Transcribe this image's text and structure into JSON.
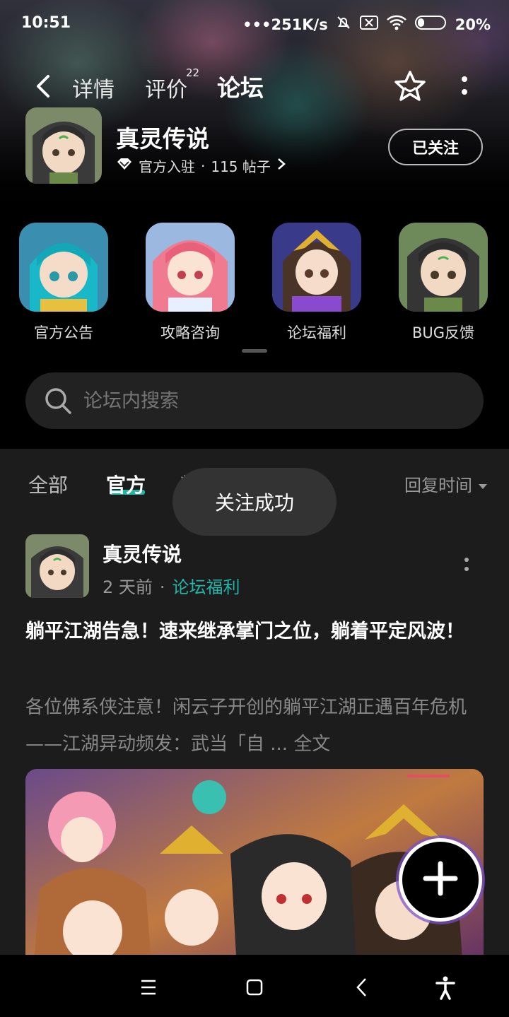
{
  "status_bar": {
    "time": "10:51",
    "network_speed": "251K/s",
    "battery": "20%"
  },
  "nav": {
    "tabs": [
      {
        "label": "详情"
      },
      {
        "label": "评价",
        "badge": "22"
      },
      {
        "label": "论坛"
      }
    ],
    "active_tab": "论坛"
  },
  "forum": {
    "name": "真灵传说",
    "official_label": "官方入驻",
    "post_count_label": "115 帖子",
    "follow_button": "已关注"
  },
  "categories": [
    {
      "label": "官方公告"
    },
    {
      "label": "攻略咨询"
    },
    {
      "label": "论坛福利"
    },
    {
      "label": "BUG反馈"
    }
  ],
  "search": {
    "placeholder": "论坛内搜索"
  },
  "filter_tabs": [
    {
      "label": "全部"
    },
    {
      "label": "官方"
    },
    {
      "label": "精"
    }
  ],
  "sort_label": "回复时间",
  "toast": "关注成功",
  "post": {
    "author": "真灵传说",
    "time": "2 天前",
    "separator": "·",
    "board": "论坛福利",
    "title": "躺平江湖告急！速来继承掌门之位，躺着平定风波！",
    "body": "各位佛系侠注意！闲云子开创的躺平江湖正遇百年危机——江湖异动频发：武当「自 ...",
    "full_text_link": "全文"
  },
  "colors": {
    "accent": "#23b5a8",
    "background": "#000000",
    "panel": "#1c1c1c"
  },
  "icons": [
    "back-icon",
    "star-icon",
    "more-vertical-icon",
    "diamond-icon",
    "chevron-right-icon",
    "search-icon",
    "dropdown-arrow-icon",
    "plus-icon",
    "menu-icon",
    "home-square-icon",
    "back-triangle-icon",
    "accessibility-icon"
  ]
}
